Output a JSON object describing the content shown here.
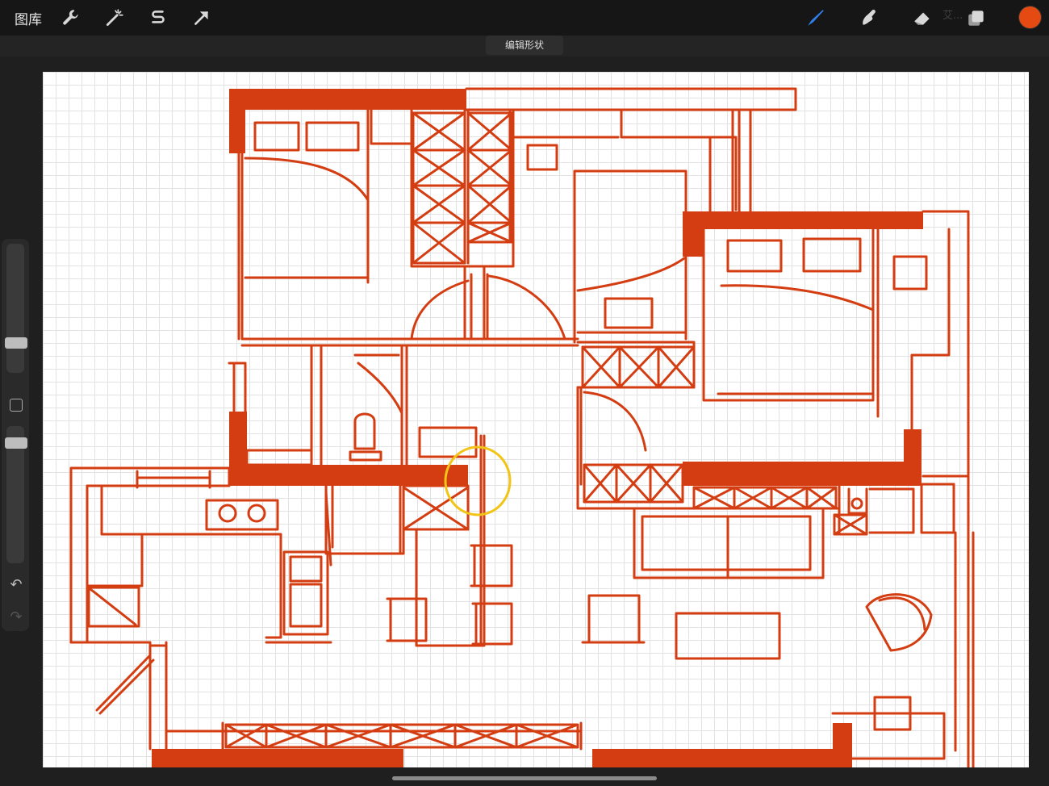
{
  "toolbar": {
    "gallery_label": "图库",
    "left_tools": [
      {
        "name": "actions",
        "icon": "wrench-icon"
      },
      {
        "name": "adjustments",
        "icon": "magic-wand-icon"
      },
      {
        "name": "selection",
        "icon": "selection-s-icon"
      },
      {
        "name": "transform",
        "icon": "arrow-cursor-icon"
      }
    ],
    "right_tools": [
      {
        "name": "brush",
        "icon": "brush-icon",
        "active": true
      },
      {
        "name": "smudge",
        "icon": "smudge-finger-icon"
      },
      {
        "name": "eraser",
        "icon": "eraser-icon"
      },
      {
        "name": "layers",
        "icon": "layers-icon"
      }
    ],
    "current_color": "#e44a12",
    "active_tool_color": "#2f7fe8",
    "watermark_text": "艾..."
  },
  "edit_shape_label": "编辑形状",
  "sidebar": {
    "brush_size_icon": "size-slider",
    "modify_icon": "square-modify-icon",
    "opacity_icon": "opacity-slider",
    "undo_icon": "undo-arrow-icon",
    "redo_icon": "redo-arrow-icon",
    "undo_glyph": "↶",
    "redo_glyph": "↷"
  },
  "canvas": {
    "drawing_color": "#d43d12",
    "highlight_color": "#f2c417",
    "grid_color": "#e2e2e2"
  }
}
